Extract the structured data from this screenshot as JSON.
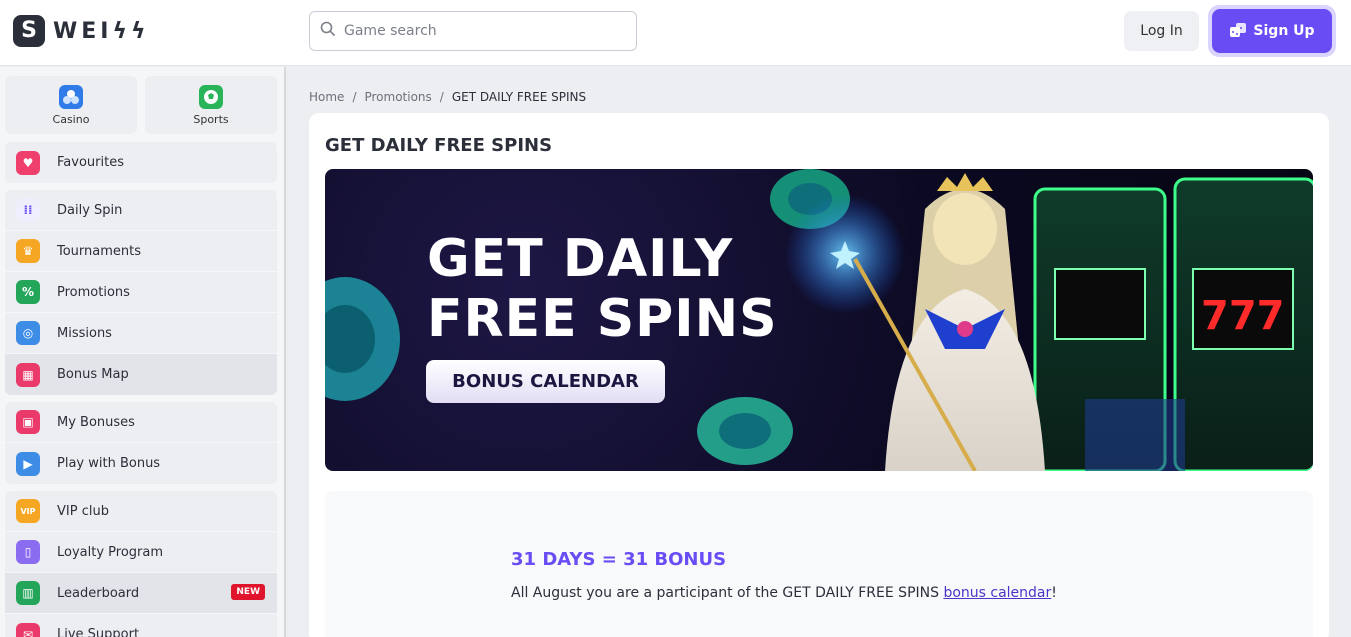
{
  "header": {
    "logo_letter": "S",
    "logo_text": "WEIϟϟ",
    "search_placeholder": "Game search",
    "login_label": "Log In",
    "signup_label": "Sign Up"
  },
  "sidebar": {
    "top_tabs": [
      {
        "label": "Casino",
        "icon": "casino-icon"
      },
      {
        "label": "Sports",
        "icon": "soccer-ball-icon"
      }
    ],
    "favourites": "Favourites",
    "group1": [
      "Daily Spin",
      "Tournaments",
      "Promotions",
      "Missions",
      "Bonus Map"
    ],
    "group2": [
      "My Bonuses",
      "Play with Bonus"
    ],
    "group3": [
      "VIP club",
      "Loyalty Program",
      "Leaderboard",
      "Live Support"
    ],
    "new_badge": "NEW",
    "colors": {
      "accent": "#6a4cf5",
      "badge": "#e0142c"
    }
  },
  "breadcrumb": {
    "home": "Home",
    "sep": "/",
    "promotions": "Promotions",
    "current": "GET DAILY FREE SPINS"
  },
  "main": {
    "title": "GET DAILY FREE SPINS",
    "banner_line1": "GET DAILY",
    "banner_line2": "FREE SPINS",
    "banner_button": "BONUS CALENDAR",
    "promo_heading": "31 DAYS = 31 BONUS",
    "promo_text_before": "All August you are a participant of the GET DAILY FREE SPINS ",
    "promo_link": "bonus calendar",
    "promo_text_after": "!"
  }
}
